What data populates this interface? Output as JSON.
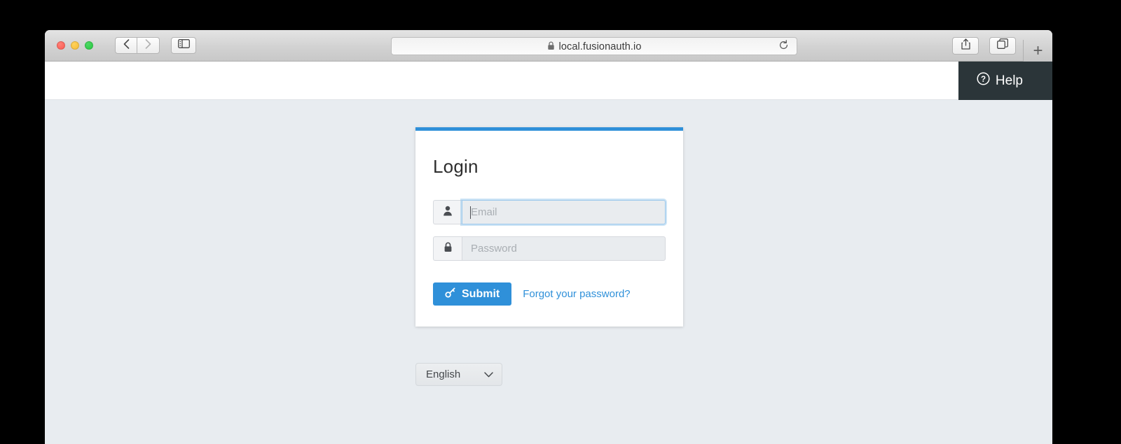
{
  "browser": {
    "url": "local.fusionauth.io",
    "lock_icon": "lock-icon",
    "back_icon": "chevron-left-icon",
    "forward_icon": "chevron-right-icon",
    "sidebar_icon": "sidebar-toggle-icon",
    "reload_icon": "reload-icon",
    "share_icon": "share-icon",
    "tabs_icon": "show-tabs-icon",
    "new_tab_label": "+"
  },
  "header": {
    "help_label": "Help",
    "help_icon": "question-circle-icon"
  },
  "login": {
    "title": "Login",
    "email": {
      "placeholder": "Email",
      "value": "",
      "icon": "user-icon"
    },
    "password": {
      "placeholder": "Password",
      "value": "",
      "icon": "lock-icon"
    },
    "submit_label": "Submit",
    "submit_icon": "key-icon",
    "forgot_label": "Forgot your password?",
    "accent_color": "#2f90d9"
  },
  "language": {
    "selected": "English",
    "chevron_icon": "chevron-down-icon"
  }
}
